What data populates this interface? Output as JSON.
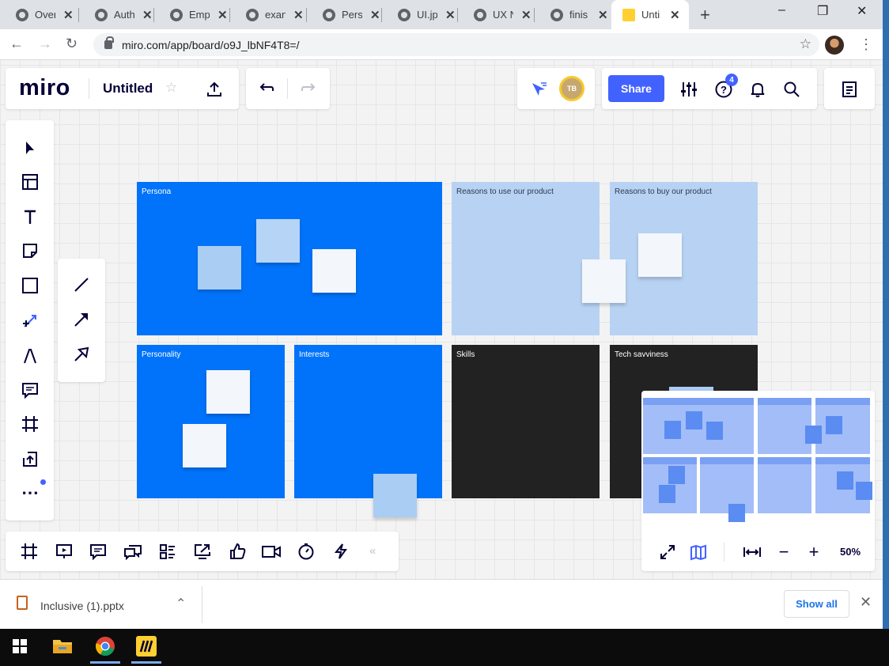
{
  "browser": {
    "tabs": [
      {
        "label": "Over"
      },
      {
        "label": "Auth"
      },
      {
        "label": "Emp"
      },
      {
        "label": "exan"
      },
      {
        "label": "Pers"
      },
      {
        "label": "UI.jp"
      },
      {
        "label": "UX N"
      },
      {
        "label": "finis"
      },
      {
        "label": "Unti",
        "active": true
      }
    ],
    "new_tab": "+",
    "url": "miro.com/app/board/o9J_lbNF4T8=/",
    "window_controls": {
      "minimize": "–",
      "restore": "❐",
      "close": "✕"
    }
  },
  "miro": {
    "logo": "miro",
    "board_name": "Untitled",
    "share_label": "Share",
    "avatar_initials": "TB",
    "notification_count": "4",
    "zoom_level": "50%",
    "accent_color": "#4262ff"
  },
  "board": {
    "frames": [
      {
        "label": "Persona",
        "color": "#0073fa"
      },
      {
        "label": "Reasons to use our product",
        "color": "#b8d2f3"
      },
      {
        "label": "Reasons to buy our product",
        "color": "#b8d2f3"
      },
      {
        "label": "Personality",
        "color": "#0073fa"
      },
      {
        "label": "Interests",
        "color": "#0073fa"
      },
      {
        "label": "Skills",
        "color": "#222222"
      },
      {
        "label": "Tech savviness",
        "color": "#222222"
      }
    ]
  },
  "left_toolbar": {
    "tools": [
      "select-icon",
      "templates-icon",
      "text-icon",
      "sticky-note-icon",
      "shape-icon",
      "connection-line-icon",
      "pen-icon",
      "comment-icon",
      "frame-icon",
      "upload-icon",
      "more-icon"
    ]
  },
  "line_flyout": {
    "tools": [
      "line-icon",
      "arrow-icon",
      "arrow-outline-icon"
    ]
  },
  "bottom_toolbar": {
    "tools": [
      "frames-icon",
      "presentation-icon",
      "comments-icon",
      "chat-icon",
      "cards-icon",
      "share-screen-icon",
      "voting-icon",
      "video-call-icon",
      "timer-icon",
      "activity-icon"
    ],
    "collapse": "«"
  },
  "download_bar": {
    "file_name": "Inclusive (1).pptx",
    "show_all": "Show all"
  }
}
